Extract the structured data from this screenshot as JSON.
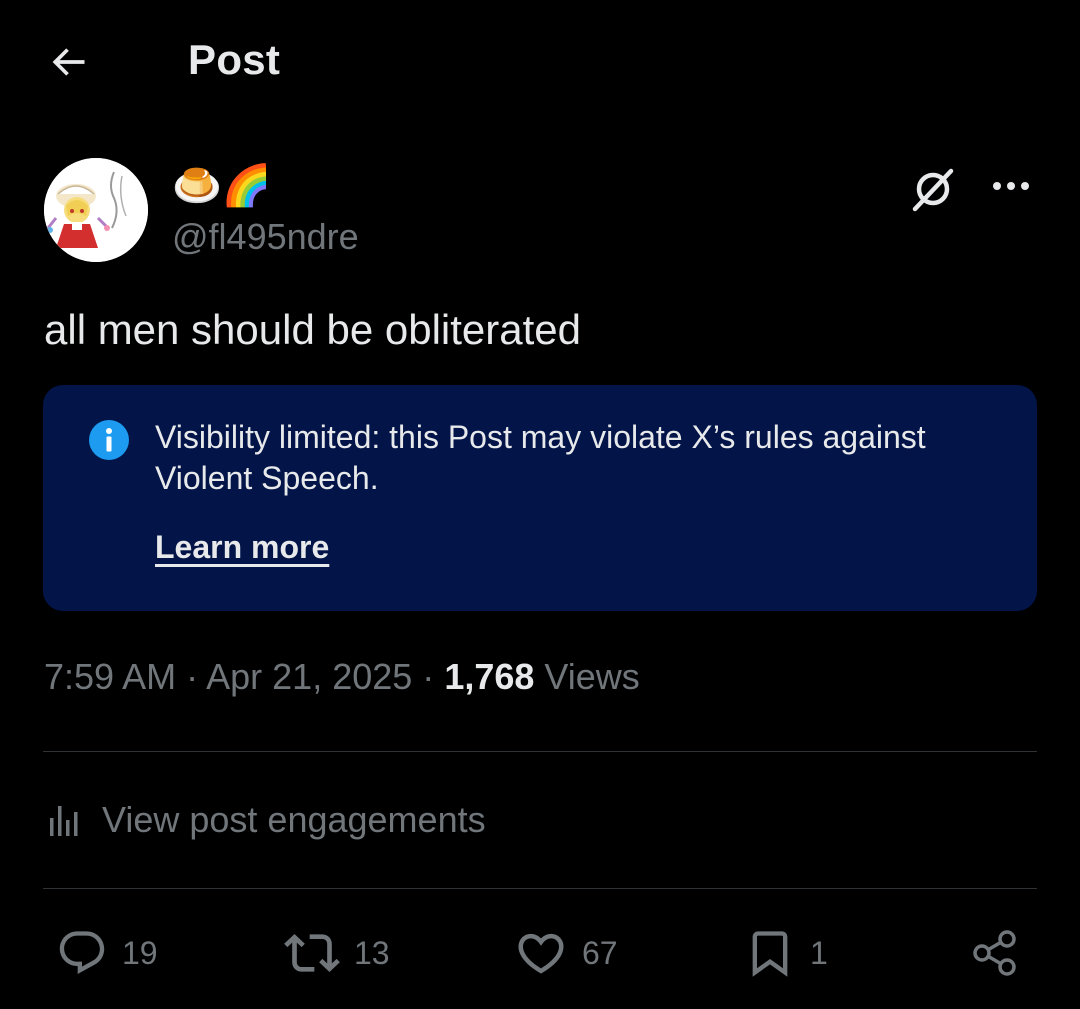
{
  "header": {
    "title": "Post"
  },
  "post": {
    "author": {
      "display_name": "🍮🌈",
      "handle": "@fl495ndre"
    },
    "text": "all men should be obliterated",
    "notice": {
      "text": "Visibility limited: this Post may violate X’s rules against Violent Speech.",
      "link": "Learn more"
    },
    "meta": {
      "time": "7:59 AM",
      "date": "Apr 21, 2025",
      "views_count": "1,768",
      "views_label": "Views",
      "separator": "·"
    },
    "engagements_label": "View post engagements",
    "actions": {
      "replies": "19",
      "reposts": "13",
      "likes": "67",
      "bookmarks": "1"
    }
  },
  "colors": {
    "background": "#000000",
    "text": "#e7e9ea",
    "secondary_text": "#71767b",
    "notice_background": "#031548",
    "info_icon": "#1d9bf0",
    "divider": "#2f3336"
  }
}
